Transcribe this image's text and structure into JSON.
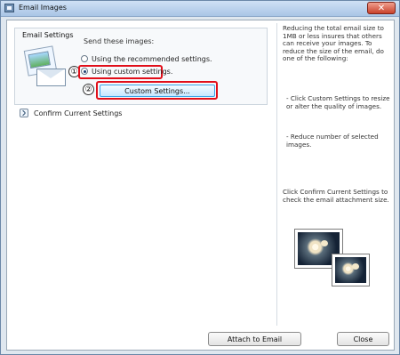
{
  "window": {
    "title": "Email Images",
    "close_glyph": "✕",
    "app_icon": "email-images-app-icon"
  },
  "settings": {
    "group_title": "Email Settings",
    "send_label": "Send these images:",
    "option_recommended": "Using the recommended settings.",
    "option_custom": "Using custom settings.",
    "selected_option": "custom",
    "custom_settings_button": "Custom Settings...",
    "confirm_label": "Confirm Current Settings",
    "callouts": [
      "①",
      "②"
    ]
  },
  "help": {
    "intro": "Reducing the total email size to 1MB or less insures that others can receive your images. To reduce the size of the email, do one of the following:",
    "tip_custom": "- Click Custom Settings to resize or alter the quality of images.",
    "tip_reduce": "- Reduce number of selected images.",
    "confirm_note": "Click Confirm Current Settings to check the email attachment size."
  },
  "footer": {
    "attach_button": "Attach to Email",
    "close_button": "Close"
  },
  "colors": {
    "highlight": "#e10f1a",
    "primary_button_border": "#37a3e7",
    "window_border": "#6b87a8"
  }
}
